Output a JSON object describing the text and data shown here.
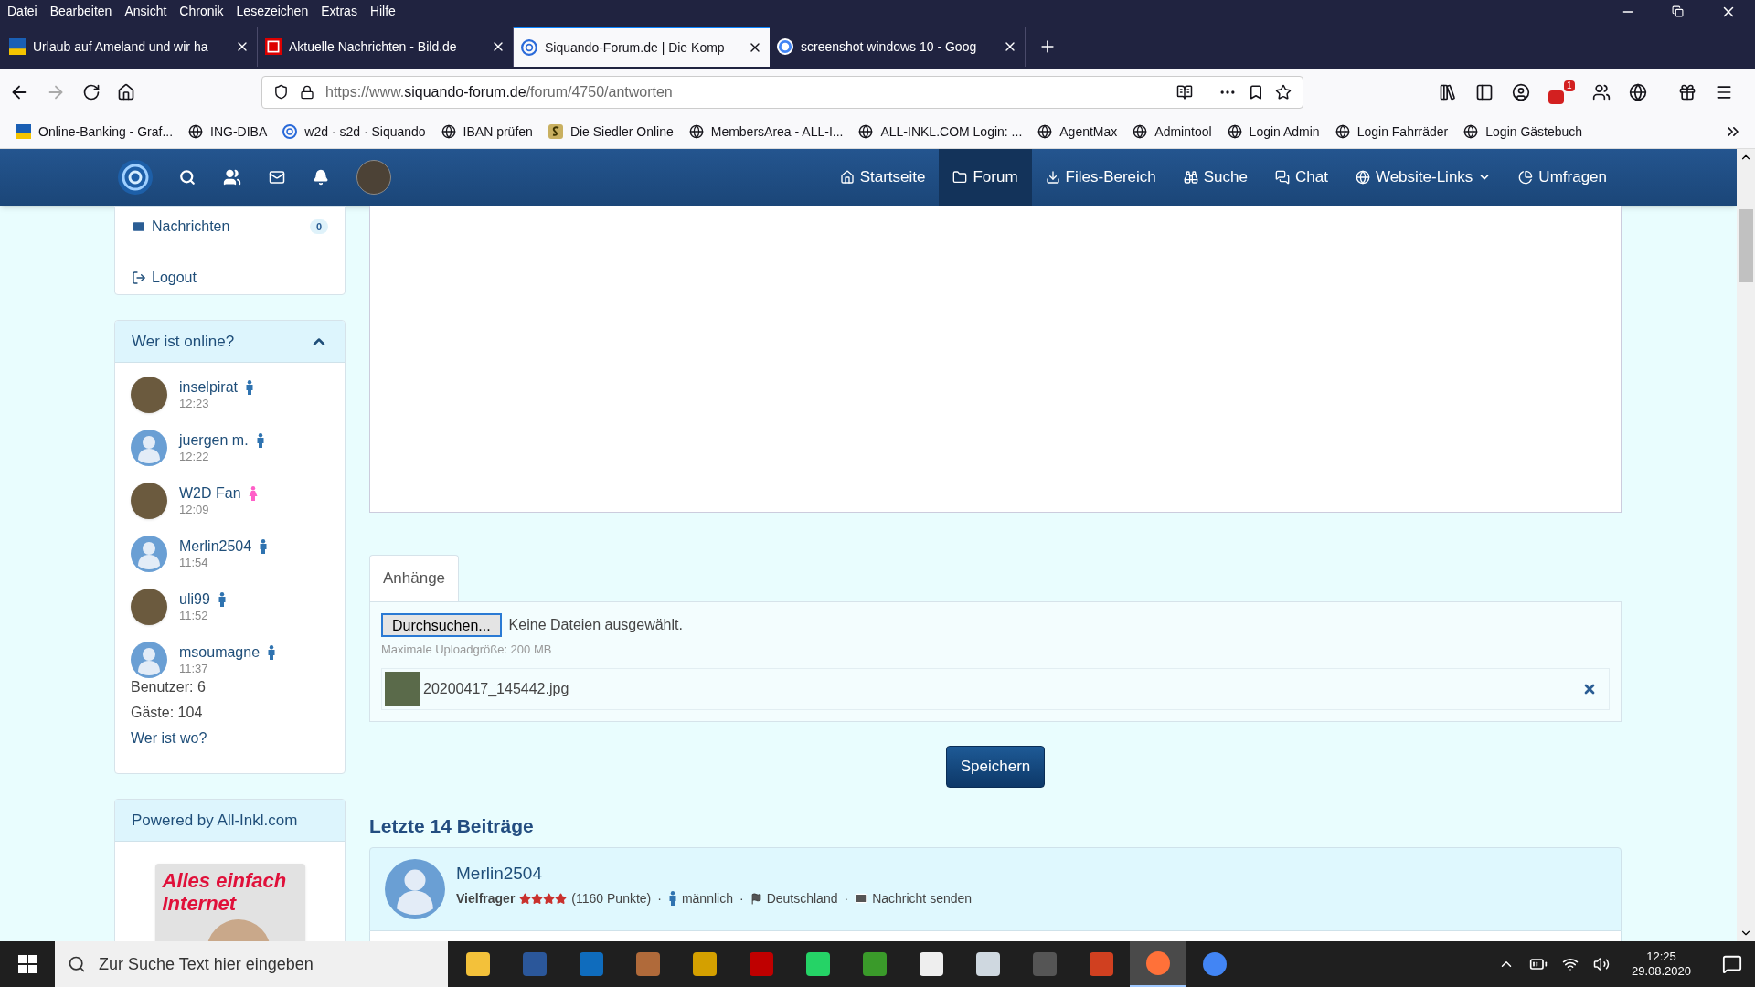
{
  "menu_bar": [
    "Datei",
    "Bearbeiten",
    "Ansicht",
    "Chronik",
    "Lesezeichen",
    "Extras",
    "Hilfe"
  ],
  "tabs": [
    {
      "title": "Urlaub auf Ameland und wir ha",
      "selected": false
    },
    {
      "title": "Aktuelle Nachrichten - Bild.de",
      "selected": false
    },
    {
      "title": "Siquando-Forum.de | Die Komp",
      "selected": true
    },
    {
      "title": "screenshot windows 10 - Goog",
      "selected": false
    }
  ],
  "url": {
    "prefix": "https://www.",
    "domain": "siquando-forum.de",
    "path": "/forum/4750/antworten"
  },
  "extension_badge": "1",
  "bookmarks": [
    "Online-Banking - Graf...",
    "ING-DIBA",
    "w2d · s2d · Siquando",
    "IBAN prüfen",
    "Die Siedler Online",
    "MembersArea - ALL-I...",
    "ALL-INKL.COM Login: ...",
    "AgentMax",
    "Admintool",
    "Login Admin",
    "Login Fahrräder",
    "Login Gästebuch"
  ],
  "site_nav": [
    {
      "label": "Startseite",
      "selected": false,
      "dropdown": false
    },
    {
      "label": "Forum",
      "selected": true,
      "dropdown": false
    },
    {
      "label": "Files-Bereich",
      "selected": false,
      "dropdown": false
    },
    {
      "label": "Suche",
      "selected": false,
      "dropdown": false
    },
    {
      "label": "Chat",
      "selected": false,
      "dropdown": false
    },
    {
      "label": "Website-Links",
      "selected": false,
      "dropdown": true
    },
    {
      "label": "Umfragen",
      "selected": false,
      "dropdown": false
    }
  ],
  "account_menu": {
    "messages_label": "Nachrichten",
    "messages_count": "0",
    "logout_label": "Logout"
  },
  "online": {
    "title": "Wer ist online?",
    "expanded": true,
    "users": [
      {
        "name": "inselpirat",
        "time": "12:23",
        "female": false,
        "has_photo": true
      },
      {
        "name": "juergen m.",
        "time": "12:22",
        "female": false,
        "has_photo": false
      },
      {
        "name": "W2D Fan",
        "time": "12:09",
        "female": true,
        "has_photo": true
      },
      {
        "name": "Merlin2504",
        "time": "11:54",
        "female": false,
        "has_photo": false
      },
      {
        "name": "uli99",
        "time": "11:52",
        "female": false,
        "has_photo": true
      },
      {
        "name": "msoumagne",
        "time": "11:37",
        "female": false,
        "has_photo": false
      }
    ],
    "members": "Benutzer: 6",
    "guests": "Gäste: 104",
    "where_link": "Wer ist wo?"
  },
  "sponsor": {
    "title": "Powered by All-Inkl.com",
    "ad_text": "Alles einfach Internet"
  },
  "attachments": {
    "tab": "Anhänge",
    "browse_button": "Durchsuchen...",
    "no_file": "Keine Dateien ausgewählt.",
    "max_size": "Maximale Uploadgröße: 200 MB",
    "files": [
      "20200417_145442.jpg"
    ]
  },
  "save_button": "Speichern",
  "recent": {
    "title": "Letzte 14 Beiträge",
    "post": {
      "author": "Merlin2504",
      "rank": "Vielfrager",
      "stars": 4,
      "points": "(1160 Punkte)",
      "gender": "männlich",
      "country": "Deutschland",
      "message": "Nachricht senden",
      "separators": [
        "·",
        "·",
        "·"
      ]
    }
  },
  "taskbar": {
    "search_placeholder": "Zur Suche Text hier eingeben",
    "apps": [
      {
        "selected": false
      },
      {
        "selected": false
      },
      {
        "selected": false
      },
      {
        "selected": false
      },
      {
        "selected": false
      },
      {
        "selected": false
      },
      {
        "selected": false
      },
      {
        "selected": false
      },
      {
        "selected": false
      },
      {
        "selected": false
      },
      {
        "selected": false
      },
      {
        "selected": false
      },
      {
        "selected": true
      },
      {
        "selected": false
      }
    ],
    "time": "12:25",
    "date": "29.08.2020"
  }
}
